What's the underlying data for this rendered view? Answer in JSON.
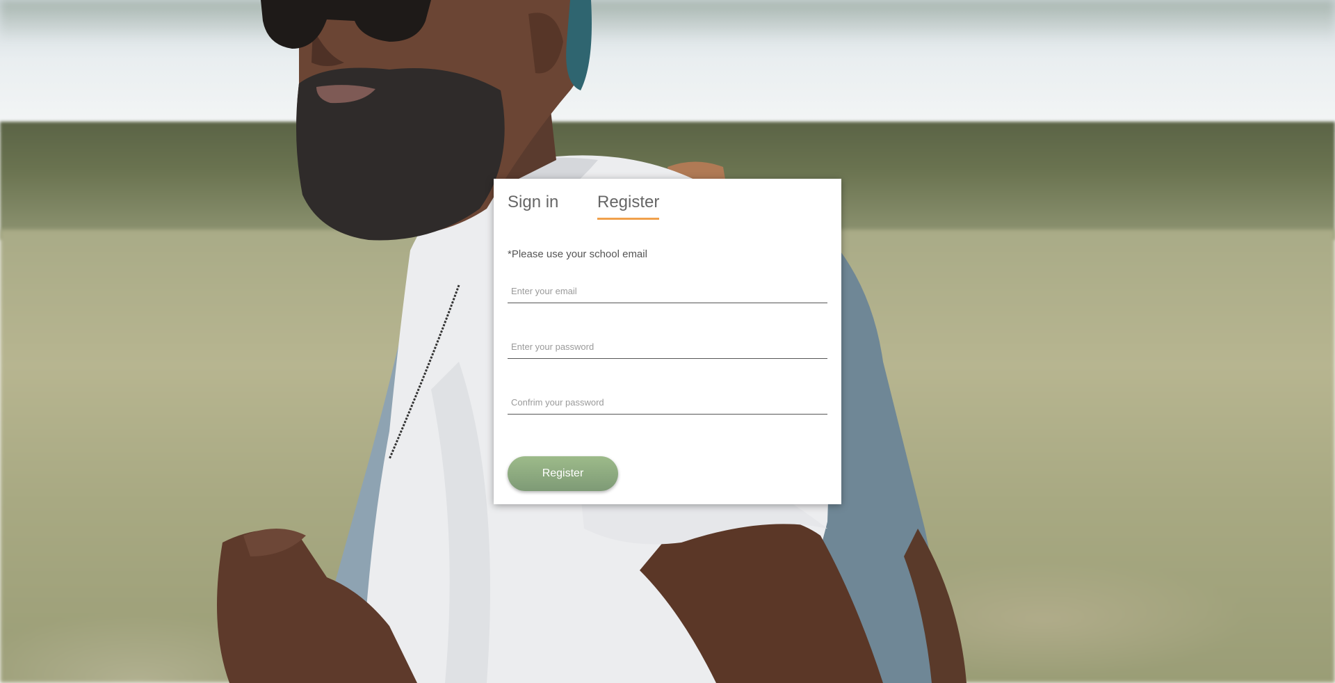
{
  "auth": {
    "tabs": [
      {
        "label": "Sign in",
        "active": false
      },
      {
        "label": "Register",
        "active": true
      }
    ],
    "note": "*Please use your school email",
    "fields": {
      "email_placeholder": "Enter your email",
      "password_placeholder": "Enter your password",
      "confirm_placeholder": "Confrim your password"
    },
    "submit_label": "Register"
  },
  "colors": {
    "active_tab_underline": "#f0a04b",
    "button_top": "#9dbb8a",
    "button_bottom": "#7e9a76"
  },
  "background": {
    "description_icon": "photo-man-with-backpack"
  }
}
